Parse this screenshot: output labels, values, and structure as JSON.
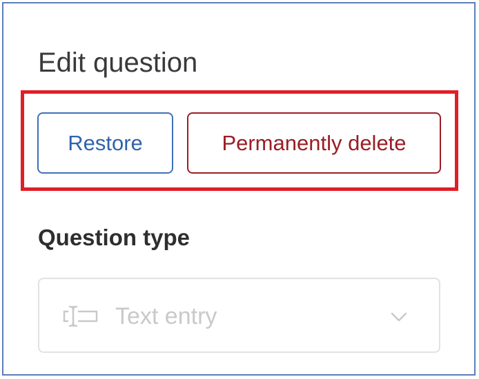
{
  "panel": {
    "title": "Edit question"
  },
  "actions": {
    "restore_label": "Restore",
    "delete_label": "Permanently delete"
  },
  "question_type": {
    "label": "Question type",
    "selected_value": "Text entry",
    "selected_icon": "text-entry-icon",
    "disabled": true
  },
  "colors": {
    "highlight": "#e01e26",
    "restore": "#2f63ad",
    "delete": "#9b1d24",
    "frame": "#5b7dba"
  }
}
